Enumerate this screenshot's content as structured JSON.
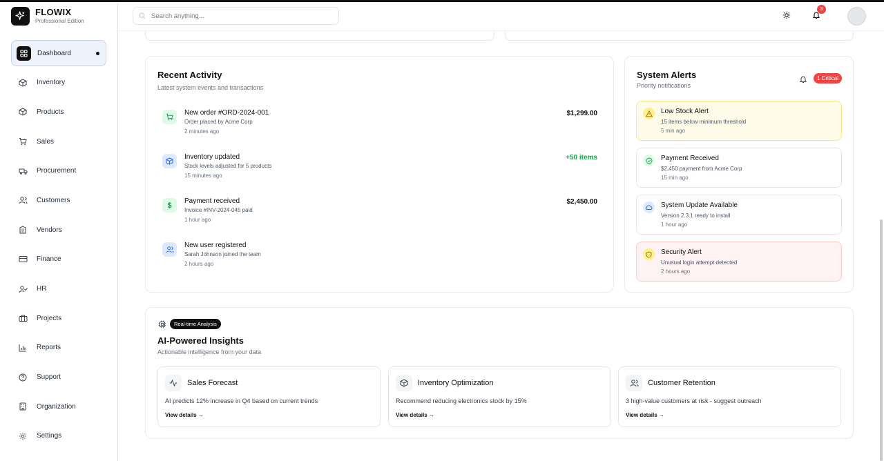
{
  "brand": {
    "name": "FLOWIX",
    "edition": "Professional Edition"
  },
  "sidebar": {
    "items": [
      {
        "label": "Dashboard",
        "icon": "grid-icon",
        "active": true
      },
      {
        "label": "Inventory",
        "icon": "box-icon"
      },
      {
        "label": "Products",
        "icon": "package-icon"
      },
      {
        "label": "Sales",
        "icon": "cart-icon"
      },
      {
        "label": "Procurement",
        "icon": "truck-icon"
      },
      {
        "label": "Customers",
        "icon": "users-icon"
      },
      {
        "label": "Vendors",
        "icon": "building-icon"
      },
      {
        "label": "Finance",
        "icon": "card-icon"
      },
      {
        "label": "HR",
        "icon": "user-check-icon"
      },
      {
        "label": "Projects",
        "icon": "briefcase-icon"
      },
      {
        "label": "Reports",
        "icon": "bar-chart-icon"
      },
      {
        "label": "Support",
        "icon": "help-icon"
      },
      {
        "label": "Organization",
        "icon": "office-icon"
      },
      {
        "label": "Settings",
        "icon": "gear-icon"
      }
    ]
  },
  "header": {
    "search_placeholder": "Search anything...",
    "notification_count": "3"
  },
  "recent_activity": {
    "title": "Recent Activity",
    "subtitle": "Latest system events and transactions",
    "items": [
      {
        "title": "New order #ORD-2024-001",
        "desc": "Order placed by Acme Corp",
        "time": "2 minutes ago",
        "amount": "$1,299.00",
        "icon": "cart-icon",
        "color": "#16a34a",
        "bg": "#dcfce7"
      },
      {
        "title": "Inventory updated",
        "desc": "Stock levels adjusted for 5 products",
        "time": "15 minutes ago",
        "amount": "+50 items",
        "icon": "box-icon",
        "color": "#2563eb",
        "bg": "#dbeafe"
      },
      {
        "title": "Payment received",
        "desc": "Invoice #INV-2024-045 paid",
        "time": "1 hour ago",
        "amount": "$2,450.00",
        "icon": "dollar-icon",
        "color": "#16a34a",
        "bg": "#dcfce7"
      },
      {
        "title": "New user registered",
        "desc": "Sarah Johnson joined the team",
        "time": "2 hours ago",
        "amount": "",
        "icon": "users-icon",
        "color": "#2563eb",
        "bg": "#dbeafe"
      }
    ]
  },
  "system_alerts": {
    "title": "System Alerts",
    "subtitle": "Priority notifications",
    "badge": "1 Critical",
    "items": [
      {
        "title": "Low Stock Alert",
        "desc": "15 items below minimum threshold",
        "time": "5 min ago",
        "icon": "warning-icon",
        "bg": "#fefce8",
        "border": "#fde68a",
        "icon_bg": "#fef08a",
        "icon_color": "#a16207"
      },
      {
        "title": "Payment Received",
        "desc": "$2,450 payment from Acme Corp",
        "time": "15 min ago",
        "icon": "check-circle-icon",
        "bg": "#ffffff",
        "border": "#e5e7eb",
        "icon_bg": "#dcfce7",
        "icon_color": "#16a34a"
      },
      {
        "title": "System Update Available",
        "desc": "Version 2.3.1 ready to install",
        "time": "1 hour ago",
        "icon": "cloud-icon",
        "bg": "#ffffff",
        "border": "#e5e7eb",
        "icon_bg": "#dbeafe",
        "icon_color": "#2563eb"
      },
      {
        "title": "Security Alert",
        "desc": "Unusual login attempt detected",
        "time": "2 hours ago",
        "icon": "shield-icon",
        "bg": "#fef2f2",
        "border": "#fecaca",
        "icon_bg": "#fef08a",
        "icon_color": "#a16207"
      }
    ]
  },
  "insights": {
    "badge": "Real-time Analysis",
    "title": "AI-Powered Insights",
    "subtitle": "Actionable intelligence from your data",
    "cards": [
      {
        "title": "Sales Forecast",
        "desc": "AI predicts 12% increase in Q4 based on current trends",
        "link": "View details →",
        "icon": "activity-icon"
      },
      {
        "title": "Inventory Optimization",
        "desc": "Recommend reducing electronics stock by 15%",
        "link": "View details →",
        "icon": "box-icon"
      },
      {
        "title": "Customer Retention",
        "desc": "3 high-value customers at risk - suggest outreach",
        "link": "View details →",
        "icon": "users-icon"
      }
    ]
  },
  "colors": {
    "accent": "#111111",
    "critical": "#ef4444",
    "positive": "#16a34a"
  }
}
